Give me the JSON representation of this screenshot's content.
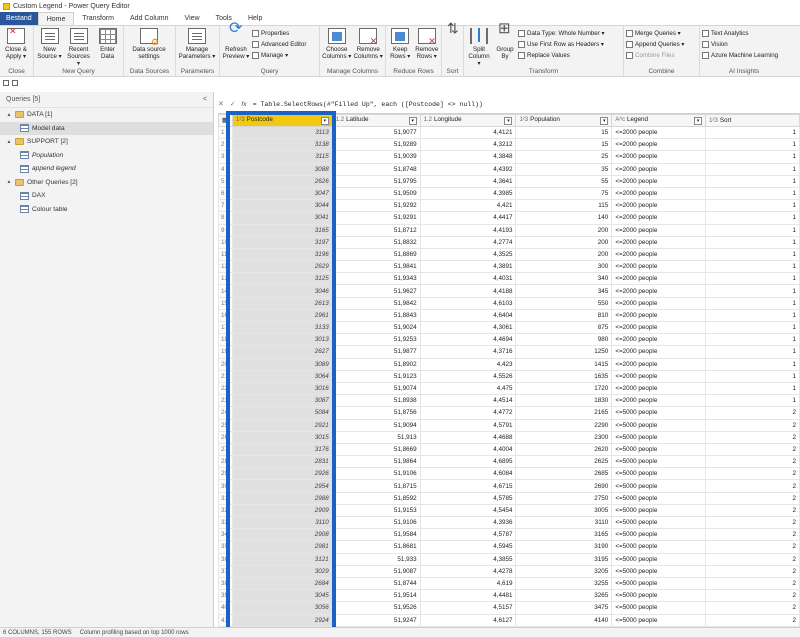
{
  "window": {
    "title": "Custom Legend - Power Query Editor"
  },
  "menu": {
    "file_label": "Bestand",
    "tabs": [
      "Home",
      "Transform",
      "Add Column",
      "View",
      "Tools",
      "Help"
    ]
  },
  "ribbon": {
    "groups": {
      "close": "Close",
      "new_query": "New Query",
      "data_sources": "Data Sources",
      "parameters": "Parameters",
      "query": "Query",
      "manage_columns": "Manage Columns",
      "reduce_rows": "Reduce Rows",
      "sort": "Sort",
      "transform": "Transform",
      "combine": "Combine",
      "ai_insights": "AI Insights"
    },
    "buttons": {
      "close_apply": "Close & Apply ▾",
      "new_source": "New Source ▾",
      "recent_sources": "Recent Sources ▾",
      "enter_data": "Enter Data",
      "data_source_settings": "Data source settings",
      "manage_parameters": "Manage Parameters ▾",
      "refresh_preview": "Refresh Preview ▾",
      "properties": "Properties",
      "advanced_editor": "Advanced Editor",
      "manage": "Manage ▾",
      "choose_columns": "Choose Columns ▾",
      "remove_columns": "Remove Columns ▾",
      "keep_rows": "Keep Rows ▾",
      "remove_rows": "Remove Rows ▾",
      "split_column": "Split Column ▾",
      "group_by": "Group By",
      "data_type": "Data Type: Whole Number ▾",
      "use_first_row": "Use First Row as Headers ▾",
      "replace_values": "Replace Values",
      "merge_queries": "Merge Queries ▾",
      "append_queries": "Append Queries ▾",
      "combine_files": "Combine Files",
      "text_analytics": "Text Analytics",
      "vision": "Vision",
      "azure_ml": "Azure Machine Learning"
    }
  },
  "queries_pane": {
    "title": "Queries [5]",
    "collapse": "<",
    "items": [
      {
        "label": "DATA [1]",
        "type": "folder"
      },
      {
        "label": "Model data",
        "type": "table",
        "selected": true
      },
      {
        "label": "SUPPORT [2]",
        "type": "folder"
      },
      {
        "label": "Population",
        "type": "table-italic"
      },
      {
        "label": "append legend",
        "type": "table-italic"
      },
      {
        "label": "Other Queries [2]",
        "type": "folder"
      },
      {
        "label": "DAX",
        "type": "table"
      },
      {
        "label": "Colour table",
        "type": "table"
      }
    ]
  },
  "formula_bar": {
    "cancel": "✕",
    "commit": "✓",
    "fx": "fx",
    "formula": "= Table.SelectRows(#\"Filled Up\", each ([Postcode] <> null))"
  },
  "grid": {
    "columns": [
      {
        "type": "1²3",
        "name": "Postcode"
      },
      {
        "type": "1.2",
        "name": "Latitude"
      },
      {
        "type": "1.2",
        "name": "Longitude"
      },
      {
        "type": "1²3",
        "name": "Population"
      },
      {
        "type": "Aᴬc",
        "name": "Legend"
      },
      {
        "type": "1²3",
        "name": "Sort"
      }
    ],
    "rows": [
      [
        "1",
        "3113",
        "51,9077",
        "4,4121",
        "15",
        "<=2000 people",
        "1"
      ],
      [
        "2",
        "3138",
        "51,9289",
        "4,3212",
        "15",
        "<=2000 people",
        "1"
      ],
      [
        "3",
        "3115",
        "51,9039",
        "4,3848",
        "25",
        "<=2000 people",
        "1"
      ],
      [
        "4",
        "3088",
        "51,8748",
        "4,4392",
        "35",
        "<=2000 people",
        "1"
      ],
      [
        "5",
        "2626",
        "51,9795",
        "4,3641",
        "55",
        "<=2000 people",
        "1"
      ],
      [
        "6",
        "3047",
        "51,9509",
        "4,3985",
        "75",
        "<=2000 people",
        "1"
      ],
      [
        "7",
        "3044",
        "51,9292",
        "4,421",
        "115",
        "<=2000 people",
        "1"
      ],
      [
        "8",
        "3041",
        "51,9291",
        "4,4417",
        "140",
        "<=2000 people",
        "1"
      ],
      [
        "9",
        "3165",
        "51,8712",
        "4,4193",
        "200",
        "<=2000 people",
        "1"
      ],
      [
        "10",
        "3197",
        "51,8832",
        "4,2774",
        "200",
        "<=2000 people",
        "1"
      ],
      [
        "11",
        "3196",
        "51,8869",
        "4,3525",
        "200",
        "<=2000 people",
        "1"
      ],
      [
        "12",
        "2629",
        "51,9841",
        "4,3891",
        "300",
        "<=2000 people",
        "1"
      ],
      [
        "13",
        "3125",
        "51,9343",
        "4,4031",
        "340",
        "<=2000 people",
        "1"
      ],
      [
        "14",
        "3046",
        "51,9627",
        "4,4188",
        "345",
        "<=2000 people",
        "1"
      ],
      [
        "15",
        "2613",
        "51,9842",
        "4,6103",
        "550",
        "<=2000 people",
        "1"
      ],
      [
        "16",
        "2961",
        "51,8843",
        "4,6404",
        "810",
        "<=2000 people",
        "1"
      ],
      [
        "17",
        "3133",
        "51,9024",
        "4,3061",
        "875",
        "<=2000 people",
        "1"
      ],
      [
        "18",
        "3013",
        "51,9253",
        "4,4694",
        "980",
        "<=2000 people",
        "1"
      ],
      [
        "19",
        "2627",
        "51,9877",
        "4,3716",
        "1250",
        "<=2000 people",
        "1"
      ],
      [
        "20",
        "3089",
        "51,8902",
        "4,423",
        "1415",
        "<=2000 people",
        "1"
      ],
      [
        "21",
        "3064",
        "51,9123",
        "4,5526",
        "1635",
        "<=2000 people",
        "1"
      ],
      [
        "22",
        "3016",
        "51,9074",
        "4,475",
        "1720",
        "<=2000 people",
        "1"
      ],
      [
        "23",
        "3087",
        "51,8938",
        "4,4514",
        "1830",
        "<=2000 people",
        "1"
      ],
      [
        "24",
        "5084",
        "51,8756",
        "4,4772",
        "2165",
        "<=5000 people",
        "2"
      ],
      [
        "25",
        "2921",
        "51,9094",
        "4,5791",
        "2290",
        "<=5000 people",
        "2"
      ],
      [
        "26",
        "3015",
        "51,913",
        "4,4688",
        "2300",
        "<=5000 people",
        "2"
      ],
      [
        "27",
        "3176",
        "51,8669",
        "4,4004",
        "2620",
        "<=5000 people",
        "2"
      ],
      [
        "28",
        "2831",
        "51,9864",
        "4,6895",
        "2625",
        "<=5000 people",
        "2"
      ],
      [
        "29",
        "2926",
        "51,9106",
        "4,6084",
        "2685",
        "<=5000 people",
        "2"
      ],
      [
        "30",
        "2954",
        "51,8715",
        "4,6715",
        "2690",
        "<=5000 people",
        "2"
      ],
      [
        "31",
        "2988",
        "51,8592",
        "4,5785",
        "2750",
        "<=5000 people",
        "2"
      ],
      [
        "32",
        "2909",
        "51,9153",
        "4,5454",
        "3005",
        "<=5000 people",
        "2"
      ],
      [
        "33",
        "3110",
        "51,9106",
        "4,3936",
        "3110",
        "<=5000 people",
        "2"
      ],
      [
        "34",
        "2908",
        "51,9584",
        "4,5787",
        "3165",
        "<=5000 people",
        "2"
      ],
      [
        "35",
        "2981",
        "51,8681",
        "4,5945",
        "3190",
        "<=5000 people",
        "2"
      ],
      [
        "36",
        "3121",
        "51,933",
        "4,3855",
        "3195",
        "<=5000 people",
        "2"
      ],
      [
        "37",
        "3029",
        "51,9087",
        "4,4278",
        "3205",
        "<=5000 people",
        "2"
      ],
      [
        "38",
        "2684",
        "51,8744",
        "4,619",
        "3255",
        "<=5000 people",
        "2"
      ],
      [
        "39",
        "3045",
        "51,9514",
        "4,4481",
        "3265",
        "<=5000 people",
        "2"
      ],
      [
        "40",
        "3056",
        "51,9526",
        "4,5157",
        "3475",
        "<=5000 people",
        "2"
      ],
      [
        "41",
        "2924",
        "51,9247",
        "4,6127",
        "4140",
        "<=5000 people",
        "2"
      ],
      [
        "42",
        "2636",
        "51,9739",
        "4,327",
        "4530",
        "<=5000 people",
        "2"
      ],
      [
        "43",
        "3033",
        "51,9283",
        "4,4696",
        "4605",
        "<=5000 people",
        "2"
      ]
    ]
  },
  "status": {
    "columns_rows": "6 COLUMNS, 155 ROWS",
    "profiling": "Column profiling based on top 1000 rows"
  },
  "highlight_color": "#1a63c4",
  "accent_color": "#f2c811"
}
